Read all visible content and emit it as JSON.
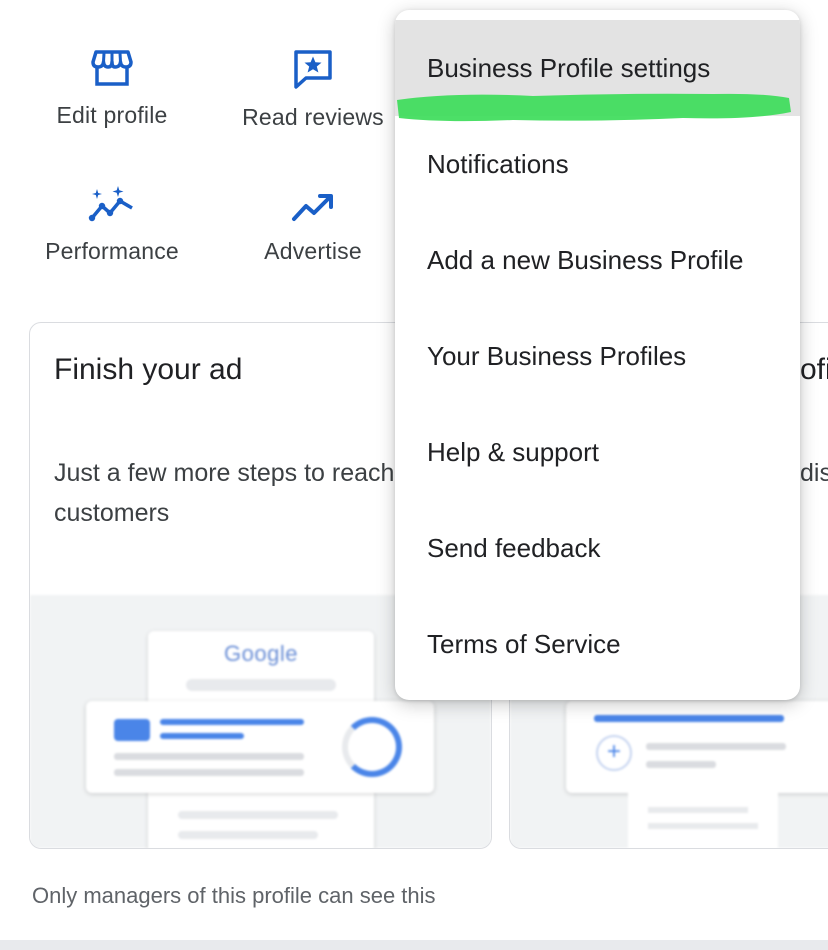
{
  "actions": [
    {
      "label": "Edit profile",
      "icon": "storefront-icon"
    },
    {
      "label": "Read reviews",
      "icon": "star-review-icon"
    },
    {
      "label": "Performance",
      "icon": "sparkle-chart-icon"
    },
    {
      "label": "Advertise",
      "icon": "trending-up-icon"
    }
  ],
  "cards": [
    {
      "title": "Finish your ad",
      "description": "Just a few more steps to reach more customers"
    },
    {
      "title": "ofil",
      "description": "dis"
    }
  ],
  "illustration": {
    "google_logo_text": "Google"
  },
  "footer_note": "Only managers of this profile can see this",
  "menu": {
    "items": [
      {
        "label": "Business Profile settings"
      },
      {
        "label": "Notifications"
      },
      {
        "label": "Add a new Business Profile"
      },
      {
        "label": "Your Business Profiles"
      },
      {
        "label": "Help & support"
      },
      {
        "label": "Send feedback"
      },
      {
        "label": "Terms of Service"
      }
    ]
  },
  "colors": {
    "accent": "#1a5fc7",
    "highlight_mark": "#3ddc5a",
    "menu_highlight": "#e3e3e3"
  }
}
